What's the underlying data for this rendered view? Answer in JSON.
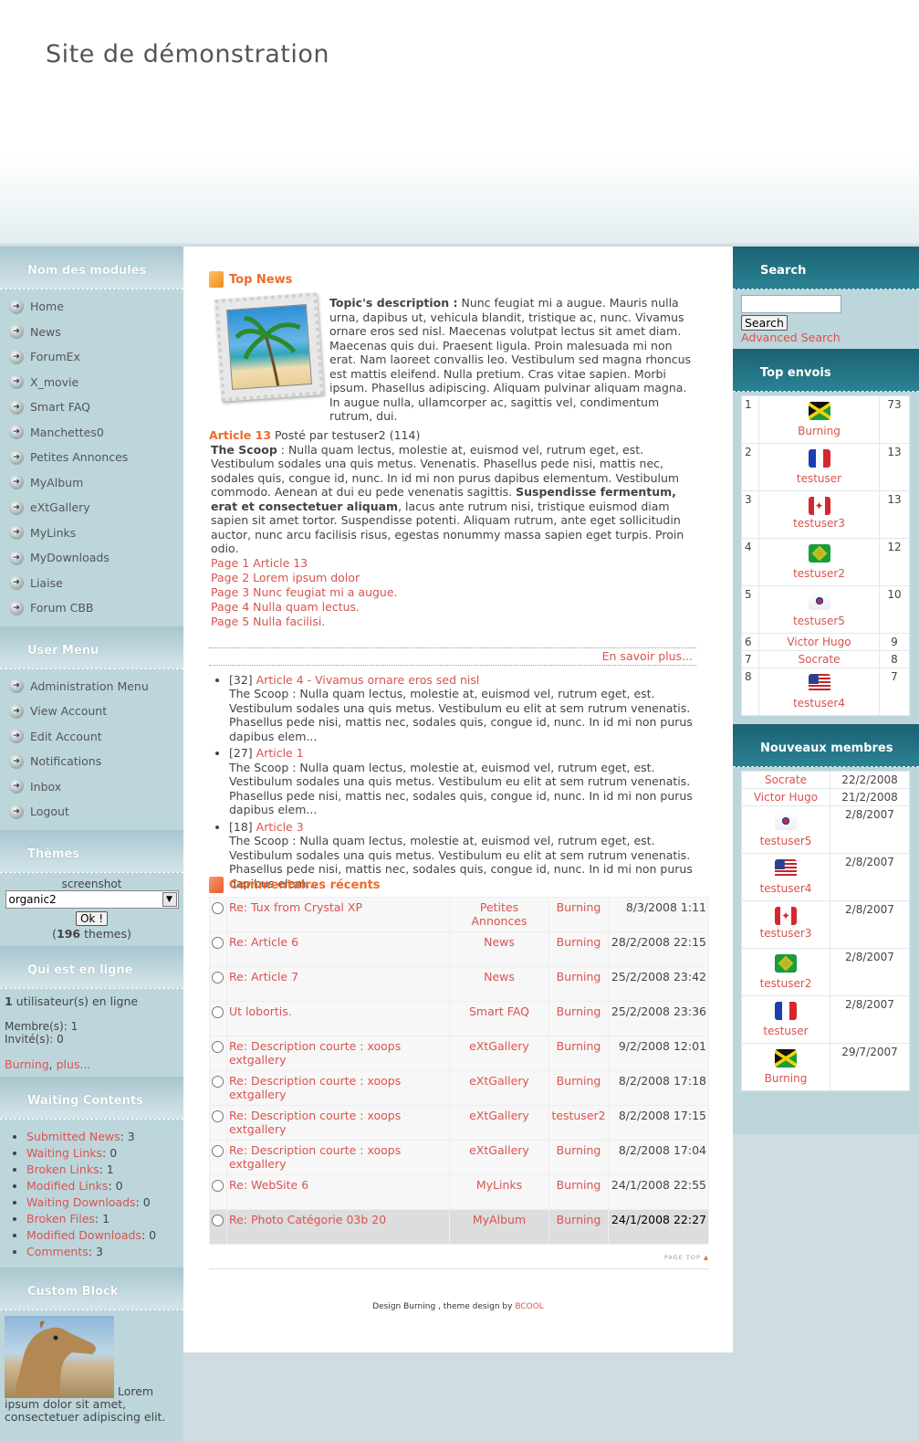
{
  "header": {
    "site_title": "Site de démonstration"
  },
  "left": {
    "modules_title": "Nom des modules",
    "modules": [
      "Home",
      "News",
      "ForumEx",
      "X_movie",
      "Smart FAQ",
      "Manchettes0",
      "Petites Annonces",
      "MyAlbum",
      "eXtGallery",
      "MyLinks",
      "MyDownloads",
      "Liaise",
      "Forum CBB"
    ],
    "usermenu_title": "User Menu",
    "usermenu": [
      "Administration Menu",
      "View Account",
      "Edit Account",
      "Notifications",
      "Inbox",
      "Logout"
    ],
    "themes_title": "Thèmes",
    "screenshot_label": "screenshot",
    "theme_selected": "organic2",
    "ok_label": "Ok !",
    "themes_count": "196",
    "themes_suffix": " themes)",
    "online_title": "Qui est en ligne",
    "online_count": "1",
    "online_text": " utilisateur(s) en ligne",
    "members": "Membre(s): 1",
    "guests": "Invité(s): 0",
    "online_user": "Burning",
    "online_more": "plus...",
    "waiting_title": "Waiting Contents",
    "waiting": [
      {
        "label": "Submitted News",
        "count": ": 3"
      },
      {
        "label": "Waiting Links",
        "count": ": 0"
      },
      {
        "label": "Broken Links",
        "count": ": 1"
      },
      {
        "label": "Modified Links",
        "count": ": 0"
      },
      {
        "label": "Waiting Downloads",
        "count": ": 0"
      },
      {
        "label": "Broken Files",
        "count": ": 1"
      },
      {
        "label": "Modified Downloads",
        "count": ": 0"
      },
      {
        "label": "Comments",
        "count": ": 3"
      }
    ],
    "custom_title": "Custom Block",
    "custom_text": "Lorem ipsum dolor sit amet, consectetuer adipiscing elit."
  },
  "center": {
    "topnews_title": "Top News",
    "topic_label": "Topic's description :",
    "topic_text": " Nunc feugiat mi a augue. Mauris nulla urna, dapibus ut, vehicula blandit, tristique ac, nunc. Vivamus ornare eros sed nisl. Maecenas volutpat lectus sit amet diam. Maecenas quis dui. Praesent ligula. Proin malesuada mi non erat. Nam laoreet convallis leo. Vestibulum sed magna rhoncus est mattis eleifend. Nulla pretium. Cras vitae sapien. Morbi ipsum. Phasellus adipiscing. Aliquam pulvinar aliquam magna. In augue nulla, ullamcorper ac, sagittis vel, condimentum rutrum, dui.",
    "article_title": "Article 13",
    "article_meta": " Posté par testuser2 (114)",
    "scoop_label": "The Scoop",
    "scoop_a": " : Nulla quam lectus, molestie at, euismod vel, rutrum eget, est. Vestibulum sodales una quis metus. Venenatis. Phasellus pede nisi, mattis nec, sodales quis, congue id, nunc. In id mi non purus dapibus elementum. Vestibulum commodo. Aenean at dui eu pede venenatis sagittis. ",
    "scoop_bold": "Suspendisse fermentum, erat et consectetuer aliquam",
    "scoop_b": ", lacus ante rutrum nisi, tristique euismod diam sapien sit amet tortor. Suspendisse potenti. Aliquam rutrum, ante eget sollicitudin auctor, nunc arcu facilisis risus, egestas nonummy massa sapien eget turpis. Proin odio.",
    "pages": [
      "Page 1 Article 13",
      "Page 2 Lorem ipsum dolor",
      "Page 3 Nunc feugiat mi a augue.",
      "Page 4 Nulla quam lectus.",
      "Page 5 Nulla facilisi."
    ],
    "readmore": "En savoir plus...",
    "news": [
      {
        "count": "[32] ",
        "title": "Article 4 - Vivamus ornare eros sed nisl",
        "text": "The Scoop : Nulla quam lectus, molestie at, euismod vel, rutrum eget, est. Vestibulum sodales una quis metus. Vestibulum eu elit at sem rutrum venenatis. Phasellus pede nisi, mattis nec, sodales quis, congue id, nunc. In id mi non purus dapibus elem..."
      },
      {
        "count": "[27] ",
        "title": "Article 1",
        "text": "The Scoop : Nulla quam lectus, molestie at, euismod vel, rutrum eget, est. Vestibulum sodales una quis metus. Vestibulum eu elit at sem rutrum venenatis. Phasellus pede nisi, mattis nec, sodales quis, congue id, nunc. In id mi non purus dapibus elem..."
      },
      {
        "count": "[18] ",
        "title": "Article 3",
        "text": "The Scoop : Nulla quam lectus, molestie at, euismod vel, rutrum eget, est. Vestibulum sodales una quis metus. Vestibulum eu elit at sem rutrum venenatis. Phasellus pede nisi, mattis nec, sodales quis, congue id, nunc. In id mi non purus dapibus elem..."
      }
    ],
    "comments_title": "Commentaires récents",
    "comments": [
      {
        "title": "Re: Tux from Crystal XP",
        "module": "Petites Annonces",
        "user": "Burning",
        "date": "8/3/2008 1:11"
      },
      {
        "title": "Re: Article 6",
        "module": "News",
        "user": "Burning",
        "date": "28/2/2008 22:15"
      },
      {
        "title": "Re: Article 7",
        "module": "News",
        "user": "Burning",
        "date": "25/2/2008 23:42"
      },
      {
        "title": "Ut lobortis.",
        "module": "Smart FAQ",
        "user": "Burning",
        "date": "25/2/2008 23:36"
      },
      {
        "title": "Re: Description courte : xoops extgallery",
        "module": "eXtGallery",
        "user": "Burning",
        "date": "9/2/2008 12:01"
      },
      {
        "title": "Re: Description courte : xoops extgallery",
        "module": "eXtGallery",
        "user": "Burning",
        "date": "8/2/2008 17:18"
      },
      {
        "title": "Re: Description courte : xoops extgallery",
        "module": "eXtGallery",
        "user": "testuser2",
        "date": "8/2/2008 17:15"
      },
      {
        "title": "Re: Description courte : xoops extgallery",
        "module": "eXtGallery",
        "user": "Burning",
        "date": "8/2/2008 17:04"
      },
      {
        "title": "Re: WebSite 6",
        "module": "MyLinks",
        "user": "Burning",
        "date": "24/1/2008 22:55"
      },
      {
        "title": "Re: Photo Catégorie 03b 20",
        "module": "MyAlbum",
        "user": "Burning",
        "date": "24/1/2008 22:27"
      }
    ],
    "pagetop": "PAGE TOP",
    "footer_a": "Design Burning  , theme design by ",
    "footer_link": "BCOOL"
  },
  "right": {
    "search_title": "Search",
    "search_button": "Search",
    "advanced": "Advanced Search",
    "top_title": "Top envois",
    "top": [
      {
        "rank": "1",
        "name": "Burning",
        "count": "73",
        "flag": "jm"
      },
      {
        "rank": "2",
        "name": "testuser",
        "count": "13",
        "flag": "fr"
      },
      {
        "rank": "3",
        "name": "testuser3",
        "count": "13",
        "flag": "ca"
      },
      {
        "rank": "4",
        "name": "testuser2",
        "count": "12",
        "flag": "br"
      },
      {
        "rank": "5",
        "name": "testuser5",
        "count": "10",
        "flag": "kr"
      },
      {
        "rank": "6",
        "name": "Victor Hugo",
        "count": "9",
        "flag": ""
      },
      {
        "rank": "7",
        "name": "Socrate",
        "count": "8",
        "flag": ""
      },
      {
        "rank": "8",
        "name": "testuser4",
        "count": "7",
        "flag": "us"
      }
    ],
    "new_title": "Nouveaux membres",
    "new": [
      {
        "name": "Socrate",
        "date": "22/2/2008",
        "flag": ""
      },
      {
        "name": "Victor Hugo",
        "date": "21/2/2008",
        "flag": ""
      },
      {
        "name": "testuser5",
        "date": "2/8/2007",
        "flag": "kr"
      },
      {
        "name": "testuser4",
        "date": "2/8/2007",
        "flag": "us"
      },
      {
        "name": "testuser3",
        "date": "2/8/2007",
        "flag": "ca"
      },
      {
        "name": "testuser2",
        "date": "2/8/2007",
        "flag": "br"
      },
      {
        "name": "testuser",
        "date": "2/8/2007",
        "flag": "fr"
      },
      {
        "name": "Burning",
        "date": "29/7/2007",
        "flag": "jm"
      }
    ]
  }
}
